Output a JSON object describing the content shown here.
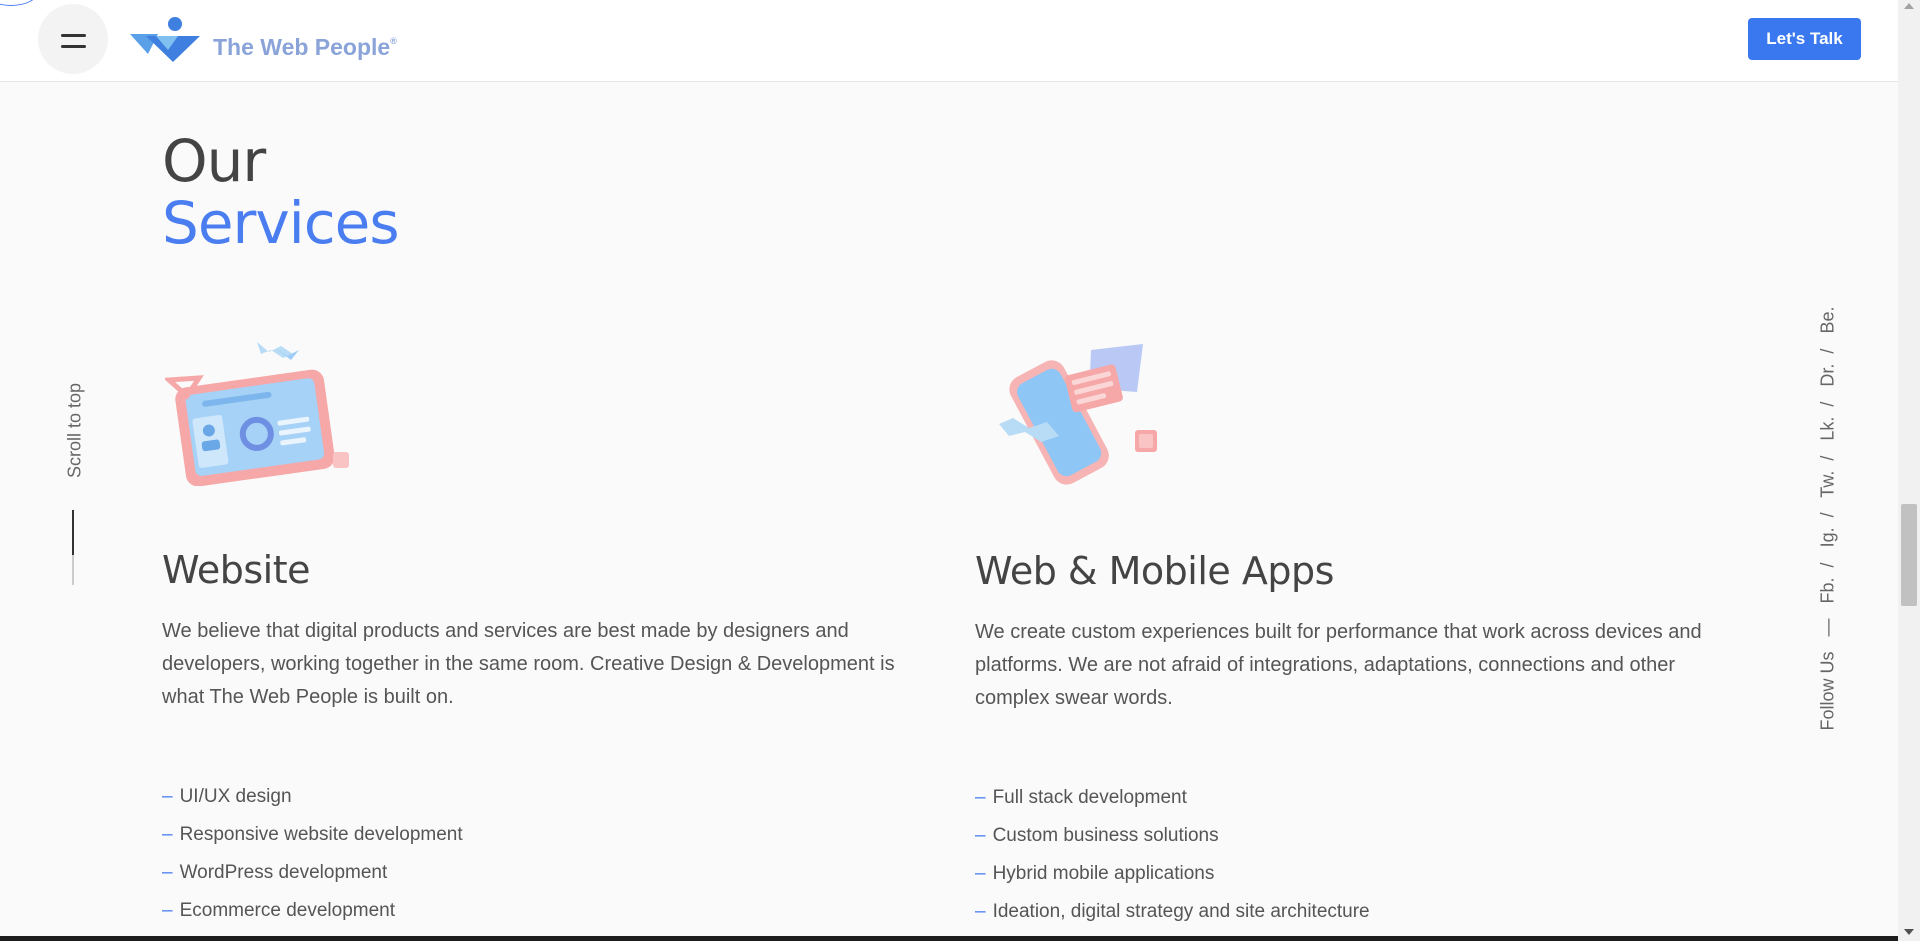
{
  "header": {
    "brand_name": "The Web People",
    "brand_mark": "®",
    "cta_label": "Let's Talk"
  },
  "section": {
    "title_line1": "Our",
    "title_line2": "Services"
  },
  "sidebar_left": {
    "scroll_label": "Scroll to top"
  },
  "social": {
    "label": "Follow Us",
    "dash": "—",
    "links": [
      "Fb.",
      "Ig.",
      "Tw.",
      "Lk.",
      "Dr.",
      "Be."
    ]
  },
  "services": [
    {
      "title": "Website",
      "description": "We believe that digital products and services are best made by designers and developers, working together in the same room. Creative Design & Development is what The Web People is built on.",
      "items": [
        "UI/UX design",
        "Responsive website development",
        "WordPress development",
        "Ecommerce development"
      ]
    },
    {
      "title": "Web & Mobile Apps",
      "description": "We create custom experiences built for performance that work across devices and platforms. We are not afraid of integrations, adaptations, connections and other complex swear words.",
      "items": [
        "Full stack development",
        "Custom business solutions",
        "Hybrid mobile applications",
        "Ideation, digital strategy and site architecture"
      ]
    }
  ],
  "list_dash": "–",
  "colors": {
    "accent": "#3a78f0",
    "heading": "#444444",
    "body_text": "#555555",
    "logo_text": "#8aa4d9",
    "illustration_pink": "#f6a7a7",
    "illustration_blue": "#9fcdf7"
  },
  "icons": [
    "menu-icon",
    "brand-logo-icon",
    "website-illustration",
    "mobile-app-illustration"
  ]
}
